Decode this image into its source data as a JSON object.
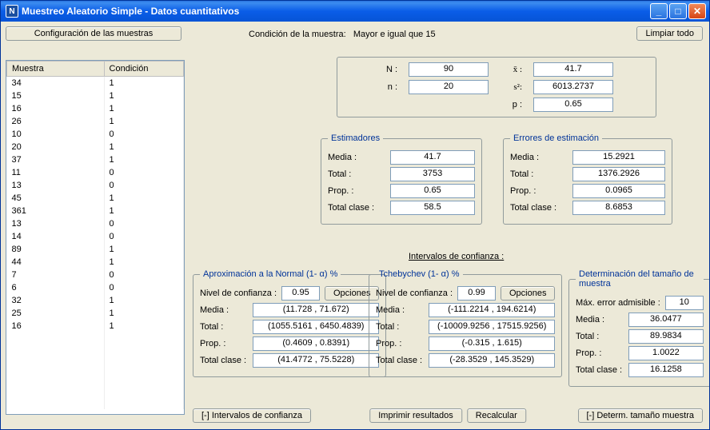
{
  "window": {
    "title": "Muestreo Aleatorio Simple - Datos cuantitativos",
    "icon_text": "N"
  },
  "toolbar": {
    "config_label": "Configuración de las muestras",
    "clear_label": "Limpiar todo",
    "condition_prefix": "Condición de la muestra:",
    "condition_value": "Mayor e igual que 15"
  },
  "table": {
    "columns": {
      "sample": "Muestra",
      "condition": "Condición"
    },
    "rows": [
      {
        "m": "34",
        "c": "1"
      },
      {
        "m": "15",
        "c": "1"
      },
      {
        "m": "16",
        "c": "1"
      },
      {
        "m": "26",
        "c": "1"
      },
      {
        "m": "10",
        "c": "0"
      },
      {
        "m": "20",
        "c": "1"
      },
      {
        "m": "37",
        "c": "1"
      },
      {
        "m": "11",
        "c": "0"
      },
      {
        "m": "13",
        "c": "0"
      },
      {
        "m": "45",
        "c": "1"
      },
      {
        "m": "361",
        "c": "1"
      },
      {
        "m": "13",
        "c": "0"
      },
      {
        "m": "14",
        "c": "0"
      },
      {
        "m": "89",
        "c": "1"
      },
      {
        "m": "44",
        "c": "1"
      },
      {
        "m": "7",
        "c": "0"
      },
      {
        "m": "6",
        "c": "0"
      },
      {
        "m": "32",
        "c": "1"
      },
      {
        "m": "25",
        "c": "1"
      },
      {
        "m": "16",
        "c": "1"
      }
    ]
  },
  "stats": {
    "N_label": "N :",
    "N": "90",
    "n_label": "n :",
    "n": "20",
    "xbar_label": "x̄ :",
    "xbar": "41.7",
    "s2_label": "s²:",
    "s2": "6013.2737",
    "p_label": "p :",
    "p": "0.65"
  },
  "estimators": {
    "legend": "Estimadores",
    "media_label": "Media :",
    "media": "41.7",
    "total_label": "Total :",
    "total": "3753",
    "prop_label": "Prop. :",
    "prop": "0.65",
    "totalc_label": "Total clase :",
    "totalc": "58.5"
  },
  "errors": {
    "legend": "Errores de estimación",
    "media_label": "Media :",
    "media": "15.2921",
    "total_label": "Total :",
    "total": "1376.2926",
    "prop_label": "Prop. :",
    "prop": "0.0965",
    "totalc_label": "Total clase :",
    "totalc": "8.6853"
  },
  "intervals_title": "Intervalos de confianza :",
  "normal": {
    "legend": "Aproximación a la Normal  (1- α) %",
    "conf_label": "Nivel de confianza :",
    "conf": "0.95",
    "options_label": "Opciones",
    "media_label": "Media :",
    "media": "(11.728 , 71.672)",
    "total_label": "Total :",
    "total": "(1055.5161 , 6450.4839)",
    "prop_label": "Prop. :",
    "prop": "(0.4609 , 0.8391)",
    "totalc_label": "Total clase :",
    "totalc": "(41.4772 , 75.5228)"
  },
  "tcheby": {
    "legend": "Tchebychev  (1- α) %",
    "conf_label": "Nivel de confianza :",
    "conf": "0.99",
    "options_label": "Opciones",
    "media_label": "Media :",
    "media": "(-111.2214 , 194.6214)",
    "total_label": "Total :",
    "total": "(-10009.9256 , 17515.9256)",
    "prop_label": "Prop. :",
    "prop": "(-0.315 , 1.615)",
    "totalc_label": "Total clase :",
    "totalc": "(-28.3529 , 145.3529)"
  },
  "size": {
    "legend": "Determinación del tamaño de muestra",
    "max_err_label": "Máx. error admisible :",
    "max_err": "10",
    "media_label": "Media :",
    "media": "36.0477",
    "total_label": "Total :",
    "total": "89.9834",
    "prop_label": "Prop. :",
    "prop": "1.0022",
    "totalc_label": "Total clase :",
    "totalc": "16.1258"
  },
  "buttons": {
    "toggle_intervals": "[-] Intervalos de confianza",
    "print": "Imprimir resultados",
    "recalc": "Recalcular",
    "toggle_size": "[-] Determ. tamaño muestra"
  }
}
